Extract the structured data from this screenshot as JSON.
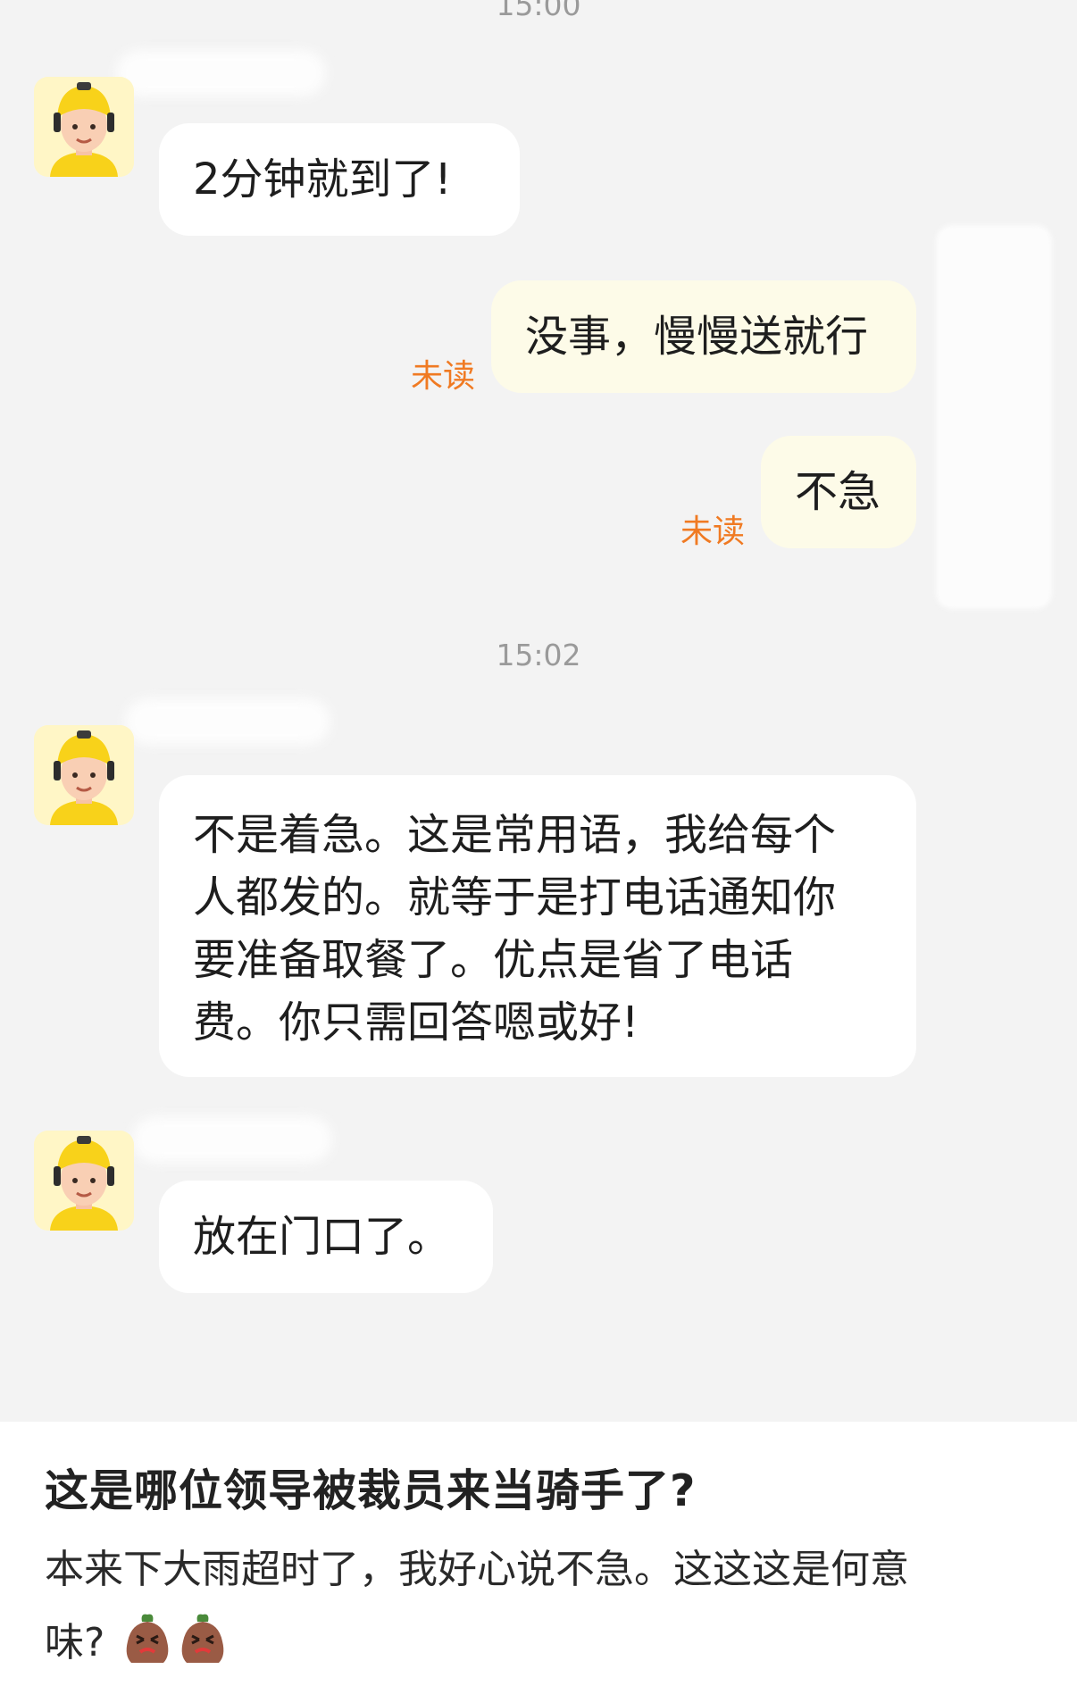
{
  "chat": {
    "timestamps": [
      "15:00",
      "15:02"
    ],
    "messages": [
      {
        "side": "in",
        "text": "2分钟就到了!"
      },
      {
        "side": "out",
        "text": "没事，慢慢送就行",
        "status": "未读"
      },
      {
        "side": "out",
        "text": "不急",
        "status": "未读"
      },
      {
        "side": "in",
        "text": "不是着急。这是常用语，我给每个人都发的。就等于是打电话通知你要准备取餐了。优点是省了电话费。你只需回答嗯或好!"
      },
      {
        "side": "in",
        "text": "放在门口了。"
      }
    ]
  },
  "post": {
    "title": "这是哪位领导被裁员来当骑手了?",
    "body_line1": "本来下大雨超时了，我好心说不急。这这这是何意",
    "body_line2": "味?",
    "emoji": [
      "cursing-face-icon",
      "cursing-face-icon"
    ]
  },
  "colors": {
    "chat_background": "#f3f3f3",
    "incoming_bubble": "#ffffff",
    "outgoing_bubble": "#fdfbe8",
    "unread_status": "#f07a22",
    "avatar_helmet": "#f8d21a"
  }
}
